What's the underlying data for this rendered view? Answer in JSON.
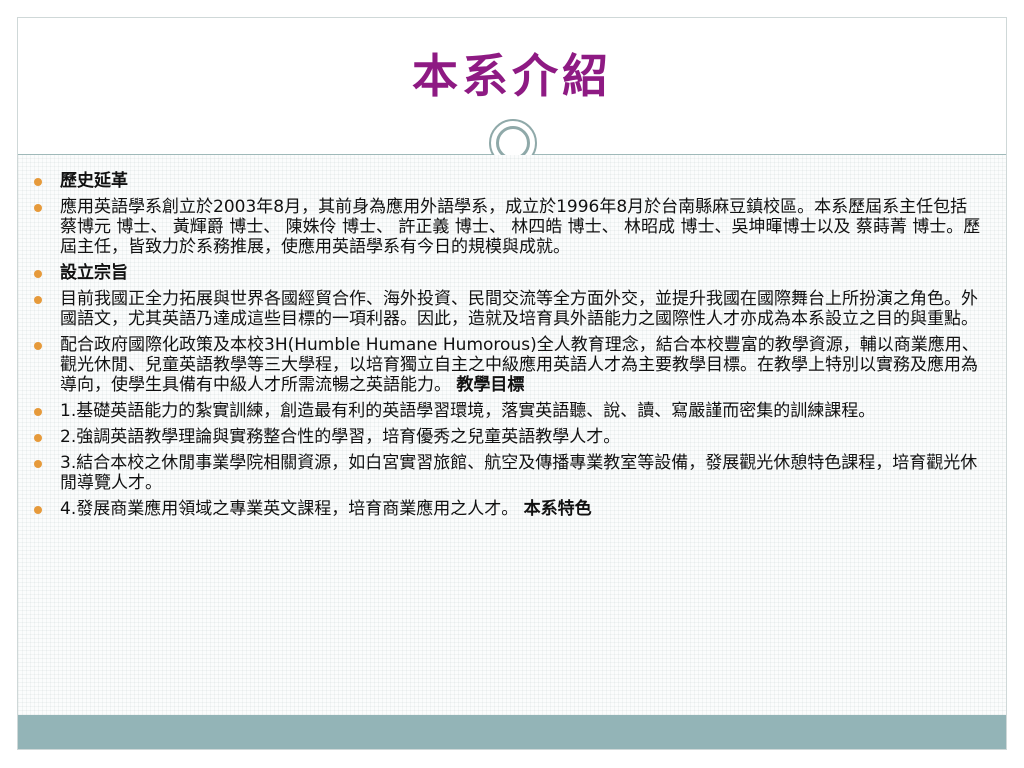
{
  "slide": {
    "title": "本系介紹",
    "items": [
      {
        "text": "歷史延革",
        "bold": true
      },
      {
        "text": "應用英語學系創立於2003年8月，其前身為應用外語學系，成立於1996年8月於台南縣麻豆鎮校區。本系歷屆系主任包括 蔡博元 博士、 黃輝爵 博士、 陳姝伶 博士、 許正義 博士、 林四皓 博士、 林昭成 博士、吳坤暉博士以及 蔡蒔菁 博士。歷屆主任，皆致力於系務推展，使應用英語學系有今日的規模與成就。"
      },
      {
        "text": "設立宗旨",
        "bold": true
      },
      {
        "text": "目前我國正全力拓展與世界各國經貿合作、海外投資、民間交流等全方面外交，並提升我國在國際舞台上所扮演之角色。外國語文，尤其英語乃達成這些目標的一項利器。因此，造就及培育具外語能力之國際性人才亦成為本系設立之目的與重點。"
      },
      {
        "text": "配合政府國際化政策及本校3H(Humble Humane Humorous)全人教育理念，結合本校豐富的教學資源，輔以商業應用、觀光休閒、兒童英語教學等三大學程，以培育獨立自主之中級應用英語人才為主要教學目標。在教學上特別以實務及應用為導向，使學生具備有中級人才所需流暢之英語能力。",
        "tail": "教學目標"
      },
      {
        "text": "1.基礎英語能力的紮實訓練，創造最有利的英語學習環境，落實英語聽、說、讀、寫嚴謹而密集的訓練課程。"
      },
      {
        "text": "2.強調英語教學理論與實務整合性的學習，培育優秀之兒童英語教學人才。"
      },
      {
        "text": "3.結合本校之休閒事業學院相關資源，如白宮實習旅館、航空及傳播專業教室等設備，發展觀光休憩特色課程，培育觀光休閒導覽人才。"
      },
      {
        "text": "4.發展商業應用領域之專業英文課程，培育商業應用之人才。",
        "tail": "本系特色"
      }
    ]
  },
  "colors": {
    "title": "#8e1a83",
    "bullet": "#e69a3b",
    "band": "#93b4b7"
  }
}
